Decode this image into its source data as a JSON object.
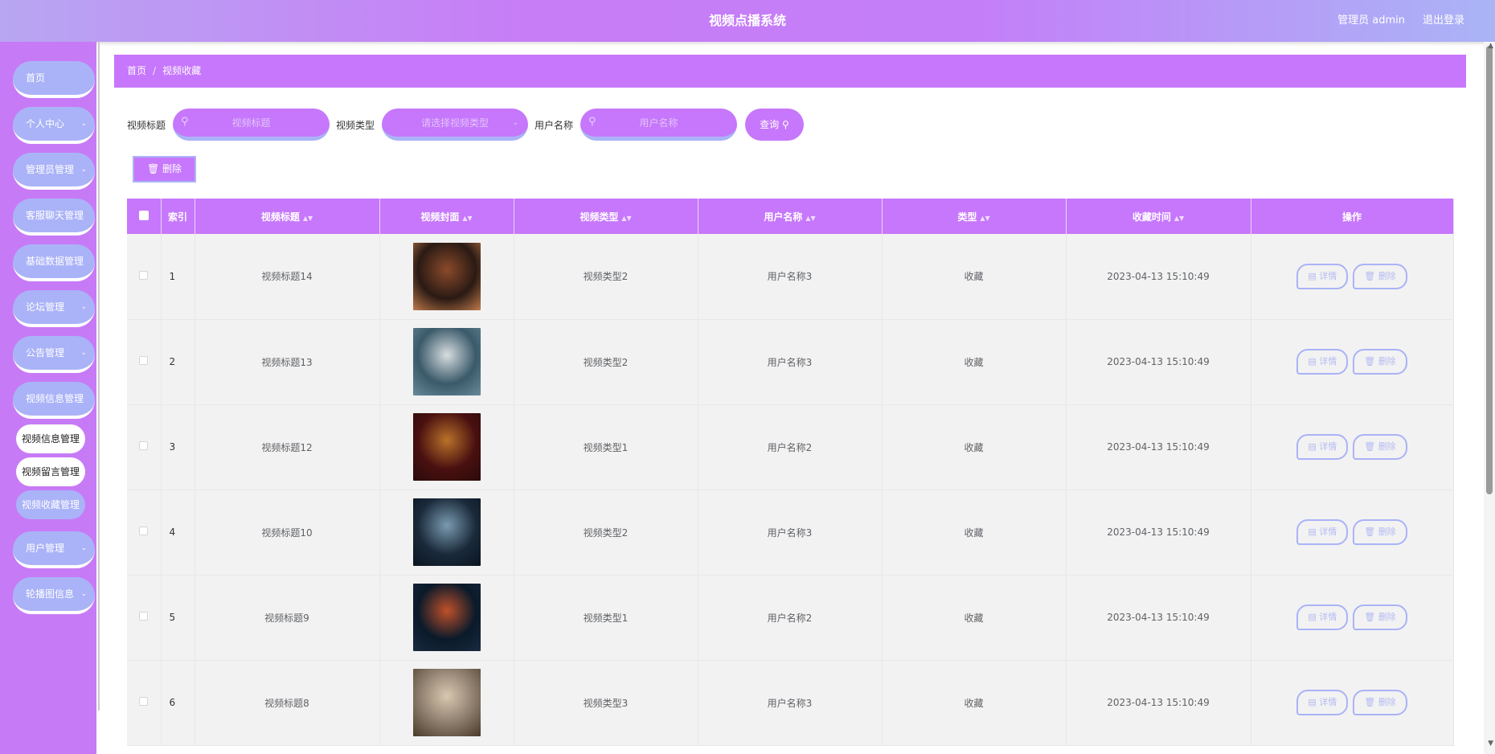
{
  "header": {
    "title": "视频点播系统",
    "admin_label": "管理员 admin",
    "logout_label": "退出登录"
  },
  "sidebar": {
    "items": [
      {
        "label": "首页",
        "has_submenu": false
      },
      {
        "label": "个人中心",
        "has_submenu": true
      },
      {
        "label": "管理员管理",
        "has_submenu": true
      },
      {
        "label": "客服聊天管理",
        "has_submenu": true
      },
      {
        "label": "基础数据管理",
        "has_submenu": true
      },
      {
        "label": "论坛管理",
        "has_submenu": true
      },
      {
        "label": "公告管理",
        "has_submenu": true
      },
      {
        "label": "视频信息管理",
        "has_submenu": true
      },
      {
        "label": "用户管理",
        "has_submenu": true
      },
      {
        "label": "轮播图信息",
        "has_submenu": true
      }
    ],
    "subitems": [
      {
        "label": "视频信息管理",
        "active": false
      },
      {
        "label": "视频留言管理",
        "active": false
      },
      {
        "label": "视频收藏管理",
        "active": true
      }
    ]
  },
  "breadcrumb": {
    "home": "首页",
    "separator": "/",
    "current": "视频收藏"
  },
  "search": {
    "title_label": "视频标题",
    "title_placeholder": "视频标题",
    "type_label": "视频类型",
    "type_placeholder": "请选择视频类型",
    "user_label": "用户名称",
    "user_placeholder": "用户名称",
    "query_label": "查询"
  },
  "toolbar": {
    "delete_label": "删除"
  },
  "table": {
    "columns": [
      "索引",
      "视频标题",
      "视频封面",
      "视频类型",
      "用户名称",
      "类型",
      "收藏时间",
      "操作"
    ],
    "rows": [
      {
        "index": "1",
        "title": "视频标题14",
        "type": "视频类型2",
        "user": "用户名称3",
        "kind": "收藏",
        "time": "2023-04-13 15:10:49",
        "cover_colors": [
          "#2a1a14",
          "#8a4a2a",
          "#c07a4a"
        ]
      },
      {
        "index": "2",
        "title": "视频标题13",
        "type": "视频类型2",
        "user": "用户名称3",
        "kind": "收藏",
        "time": "2023-04-13 15:10:49",
        "cover_colors": [
          "#3a5a6a",
          "#d8dde0",
          "#6a8a9a"
        ]
      },
      {
        "index": "3",
        "title": "视频标题12",
        "type": "视频类型1",
        "user": "用户名称2",
        "kind": "收藏",
        "time": "2023-04-13 15:10:49",
        "cover_colors": [
          "#4a1010",
          "#b8722a",
          "#2a0a0a"
        ]
      },
      {
        "index": "4",
        "title": "视频标题10",
        "type": "视频类型2",
        "user": "用户名称3",
        "kind": "收藏",
        "time": "2023-04-13 15:10:49",
        "cover_colors": [
          "#1a2a3a",
          "#7a9ab0",
          "#0a1420"
        ]
      },
      {
        "index": "5",
        "title": "视频标题9",
        "type": "视频类型1",
        "user": "用户名称2",
        "kind": "收藏",
        "time": "2023-04-13 15:10:49",
        "cover_colors": [
          "#0a1a2a",
          "#c0502a",
          "#1a2a40"
        ]
      },
      {
        "index": "6",
        "title": "视频标题8",
        "type": "视频类型3",
        "user": "用户名称3",
        "kind": "收藏",
        "time": "2023-04-13 15:10:49",
        "cover_colors": [
          "#8a7a6a",
          "#d8c8b0",
          "#4a3a2a"
        ]
      }
    ],
    "row_actions": {
      "detail_label": "详情",
      "delete_label": "删除"
    }
  },
  "colors": {
    "accent_purple": "#c677fb",
    "accent_periwinkle": "#aab3f7"
  }
}
